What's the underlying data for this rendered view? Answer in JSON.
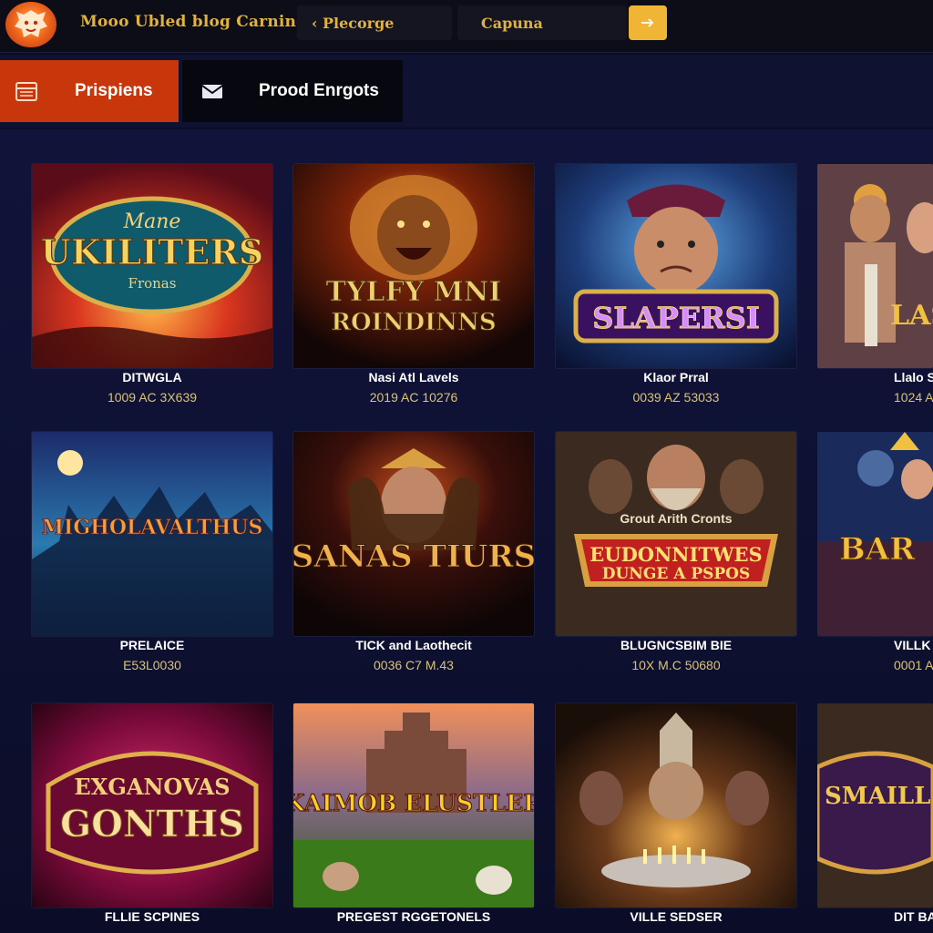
{
  "header": {
    "brand": "Mooo Ubled blog Carning",
    "back_link": "‹ Plecorge",
    "search_value": "Capuna",
    "logo_icon": "lion-logo-icon",
    "search_icon": "arrow-icon"
  },
  "tabs": [
    {
      "label": "Prispiens",
      "icon": "calendar-icon",
      "active": true
    },
    {
      "label": "Prood Enrgots",
      "icon": "mail-icon",
      "active": false
    }
  ],
  "colors": {
    "accent": "#c8360c",
    "gold": "#e2b23e",
    "search_button": "#f0b534",
    "background": "#0b0d24"
  },
  "games": [
    {
      "art_title": "UKILITERS",
      "art_top": "Mane",
      "art_sub": "Fronas",
      "title": "DITWGLA",
      "meta": "1009 AC 3X639"
    },
    {
      "art_title": "TYLFY MNI",
      "art_sub": "ROINDINNS",
      "title": "Nasi Atl Lavels",
      "meta": "2019 AC 10276"
    },
    {
      "art_title": "SLAPERSI",
      "title": "Klaor Prral",
      "meta": "0039 AZ 53033"
    },
    {
      "art_title": "LASI",
      "title": "Llalo S",
      "meta": "1024 A"
    },
    {
      "art_title": "MIGHOLAVALTHUS",
      "title": "PRELAICE",
      "meta": "E53L0030"
    },
    {
      "art_title": "SANAS TIURS",
      "title": "TICK and Laothecit",
      "meta": "0036 C7 M.43"
    },
    {
      "art_title": "EUDONNITWES",
      "art_top": "Grout Arith Cronts",
      "art_sub": "DUNGE A PSPOS",
      "title": "BLUGNCSBIM BIE",
      "meta": "10X M.C 50680"
    },
    {
      "art_title": "BAR",
      "title": "VILLK PHO",
      "meta": "0001 A"
    },
    {
      "art_title": "GONTHS",
      "art_top": "EXGANOVAS",
      "title": "FLLIE SCPINES",
      "meta": ""
    },
    {
      "art_title": "KAIMOB ELUSTLER",
      "title": "PREGEST RGGETONELS",
      "meta": ""
    },
    {
      "art_title": "",
      "title": "VILLE SEDSER",
      "meta": ""
    },
    {
      "art_title": "SMAILL STUR",
      "title": "DIT BAI",
      "meta": ""
    }
  ]
}
